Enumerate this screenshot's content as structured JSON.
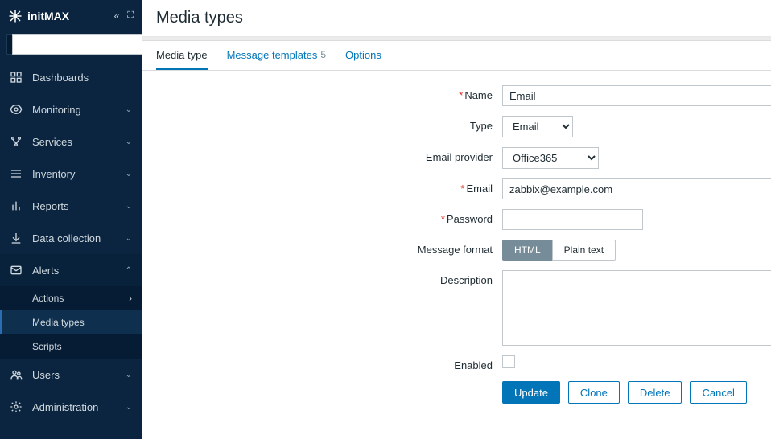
{
  "brand": "initMAX",
  "page": {
    "title": "Media types"
  },
  "sidebar": {
    "items": [
      {
        "label": "Dashboards"
      },
      {
        "label": "Monitoring"
      },
      {
        "label": "Services"
      },
      {
        "label": "Inventory"
      },
      {
        "label": "Reports"
      },
      {
        "label": "Data collection"
      },
      {
        "label": "Alerts"
      },
      {
        "label": "Users"
      },
      {
        "label": "Administration"
      }
    ],
    "alerts_sub": [
      {
        "label": "Actions"
      },
      {
        "label": "Media types"
      },
      {
        "label": "Scripts"
      }
    ]
  },
  "tabs": [
    {
      "label": "Media type"
    },
    {
      "label": "Message templates",
      "count": "5"
    },
    {
      "label": "Options"
    }
  ],
  "form": {
    "name": {
      "label": "Name",
      "value": "Email"
    },
    "type": {
      "label": "Type",
      "value": "Email"
    },
    "provider": {
      "label": "Email provider",
      "value": "Office365"
    },
    "email": {
      "label": "Email",
      "value": "zabbix@example.com"
    },
    "password": {
      "label": "Password",
      "value": ""
    },
    "msgformat": {
      "label": "Message format",
      "opt_html": "HTML",
      "opt_plain": "Plain text"
    },
    "description": {
      "label": "Description",
      "value": ""
    },
    "enabled": {
      "label": "Enabled"
    }
  },
  "buttons": {
    "update": "Update",
    "clone": "Clone",
    "delete": "Delete",
    "cancel": "Cancel"
  }
}
